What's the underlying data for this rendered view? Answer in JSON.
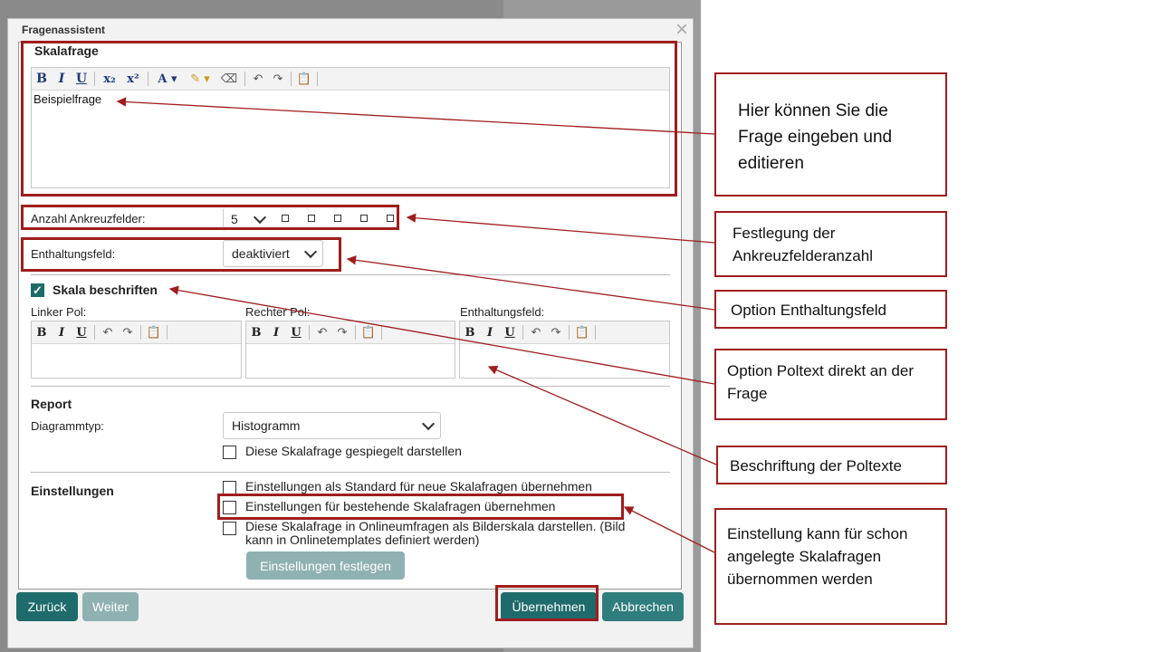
{
  "dialog": {
    "title": "Fragenassistent",
    "close_icon": "×",
    "section_title": "Skalafrage"
  },
  "main_editor": {
    "toolbar": [
      "B",
      "I",
      "U",
      "x₂",
      "x²",
      "A ▾",
      "✎ ▾",
      "⌫",
      "↶",
      "↷",
      "📋"
    ],
    "text": "Beispielfrage"
  },
  "checkbox_count": {
    "label": "Anzahl Ankreuzfelder:",
    "value": "5"
  },
  "abstain": {
    "label": "Enthaltungsfeld:",
    "value": "deaktiviert"
  },
  "scale_labels": {
    "checkbox_label": "Skala beschriften",
    "checked": true,
    "left_pole": "Linker Pol:",
    "right_pole": "Rechter Pol:",
    "abstain_field": "Enthaltungsfeld:",
    "mini_toolbar": [
      "B",
      "I",
      "U",
      "↶",
      "↷",
      "📋"
    ]
  },
  "report": {
    "heading": "Report",
    "diagram_label": "Diagrammtyp:",
    "diagram_value": "Histogramm",
    "mirror_label": "Diese Skalafrage gespiegelt darstellen"
  },
  "settings": {
    "heading": "Einstellungen",
    "opt1": "Einstellungen als Standard für neue Skalafragen übernehmen",
    "opt2": "Einstellungen für bestehende Skalafragen übernehmen",
    "opt3_line1": "Diese Skalafrage in Onlineumfragen als Bilderskala darstellen. (Bild",
    "opt3_line2": "kann in Onlinetemplates definiert werden)",
    "button": "Einstellungen festlegen"
  },
  "footer": {
    "back": "Zurück",
    "next": "Weiter",
    "apply": "Übernehmen",
    "cancel": "Abbrechen"
  },
  "callouts": {
    "c1": "Hier können Sie die Frage eingeben und editieren",
    "c2": "Festlegung der Ankreuzfelderanzahl",
    "c3": "Option Enthaltungsfeld",
    "c4": "Option Poltext direkt an der Frage",
    "c5": "Beschriftung der Poltexte",
    "c6": "Einstellung kann für schon angelegte Skalafragen übernommen werden"
  },
  "colors": {
    "accent": "#1f6b6b",
    "annotation": "#a01d1d"
  }
}
